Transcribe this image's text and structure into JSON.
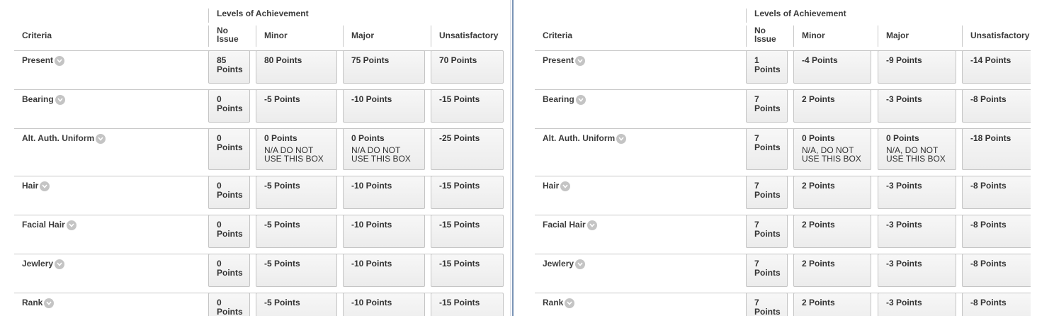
{
  "columns": {
    "criteria": "Criteria",
    "levels_label": "Levels of Achievement",
    "levels": [
      "No Issue",
      "Minor",
      "Major",
      "Unsatisfactory"
    ]
  },
  "panels": [
    {
      "rows": [
        {
          "name": "Present",
          "cells": [
            {
              "points": "85 Points",
              "desc": ""
            },
            {
              "points": "80 Points",
              "desc": ""
            },
            {
              "points": "75 Points",
              "desc": ""
            },
            {
              "points": "70 Points",
              "desc": ""
            }
          ]
        },
        {
          "name": "Bearing",
          "cells": [
            {
              "points": "0 Points",
              "desc": ""
            },
            {
              "points": "-5 Points",
              "desc": ""
            },
            {
              "points": "-10 Points",
              "desc": ""
            },
            {
              "points": "-15 Points",
              "desc": ""
            }
          ]
        },
        {
          "name": "Alt. Auth. Uniform",
          "cells": [
            {
              "points": "0 Points",
              "desc": ""
            },
            {
              "points": "0 Points",
              "desc": "N/A DO NOT USE THIS BOX"
            },
            {
              "points": "0 Points",
              "desc": "N/A DO NOT USE THIS BOX"
            },
            {
              "points": "-25 Points",
              "desc": ""
            }
          ]
        },
        {
          "name": "Hair",
          "cells": [
            {
              "points": "0 Points",
              "desc": ""
            },
            {
              "points": "-5 Points",
              "desc": ""
            },
            {
              "points": "-10 Points",
              "desc": ""
            },
            {
              "points": "-15 Points",
              "desc": ""
            }
          ]
        },
        {
          "name": "Facial Hair",
          "cells": [
            {
              "points": "0 Points",
              "desc": ""
            },
            {
              "points": "-5 Points",
              "desc": ""
            },
            {
              "points": "-10 Points",
              "desc": ""
            },
            {
              "points": "-15 Points",
              "desc": ""
            }
          ]
        },
        {
          "name": "Jewlery",
          "cells": [
            {
              "points": "0 Points",
              "desc": ""
            },
            {
              "points": "-5 Points",
              "desc": ""
            },
            {
              "points": "-10 Points",
              "desc": ""
            },
            {
              "points": "-15 Points",
              "desc": ""
            }
          ]
        },
        {
          "name": "Rank",
          "cells": [
            {
              "points": "0 Points",
              "desc": ""
            },
            {
              "points": "-5 Points",
              "desc": ""
            },
            {
              "points": "-10 Points",
              "desc": ""
            },
            {
              "points": "-15 Points",
              "desc": ""
            }
          ]
        }
      ]
    },
    {
      "rows": [
        {
          "name": "Present",
          "cells": [
            {
              "points": "1 Points",
              "desc": ""
            },
            {
              "points": "-4 Points",
              "desc": ""
            },
            {
              "points": "-9 Points",
              "desc": ""
            },
            {
              "points": "-14 Points",
              "desc": ""
            }
          ]
        },
        {
          "name": "Bearing",
          "cells": [
            {
              "points": "7 Points",
              "desc": ""
            },
            {
              "points": "2 Points",
              "desc": ""
            },
            {
              "points": "-3 Points",
              "desc": ""
            },
            {
              "points": "-8 Points",
              "desc": ""
            }
          ]
        },
        {
          "name": "Alt. Auth. Uniform",
          "cells": [
            {
              "points": "7 Points",
              "desc": ""
            },
            {
              "points": "0 Points",
              "desc": "N/A, DO NOT USE THIS BOX"
            },
            {
              "points": "0 Points",
              "desc": "N/A, DO NOT USE THIS BOX"
            },
            {
              "points": "-18 Points",
              "desc": ""
            }
          ]
        },
        {
          "name": "Hair",
          "cells": [
            {
              "points": "7 Points",
              "desc": ""
            },
            {
              "points": "2 Points",
              "desc": ""
            },
            {
              "points": "-3 Points",
              "desc": ""
            },
            {
              "points": "-8 Points",
              "desc": ""
            }
          ]
        },
        {
          "name": "Facial Hair",
          "cells": [
            {
              "points": "7 Points",
              "desc": ""
            },
            {
              "points": "2 Points",
              "desc": ""
            },
            {
              "points": "-3 Points",
              "desc": ""
            },
            {
              "points": "-8 Points",
              "desc": ""
            }
          ]
        },
        {
          "name": "Jewlery",
          "cells": [
            {
              "points": "7 Points",
              "desc": ""
            },
            {
              "points": "2 Points",
              "desc": ""
            },
            {
              "points": "-3 Points",
              "desc": ""
            },
            {
              "points": "-8 Points",
              "desc": ""
            }
          ]
        },
        {
          "name": "Rank",
          "cells": [
            {
              "points": "7 Points",
              "desc": ""
            },
            {
              "points": "2 Points",
              "desc": ""
            },
            {
              "points": "-3 Points",
              "desc": ""
            },
            {
              "points": "-8 Points",
              "desc": ""
            }
          ]
        }
      ]
    }
  ],
  "icons": {
    "row_toggle": "chevron-down-icon"
  },
  "colors": {
    "cell_bg": "#f0f0f0",
    "cell_border": "#c4c4c4",
    "text": "#333333",
    "divider": "#7a94b6"
  }
}
